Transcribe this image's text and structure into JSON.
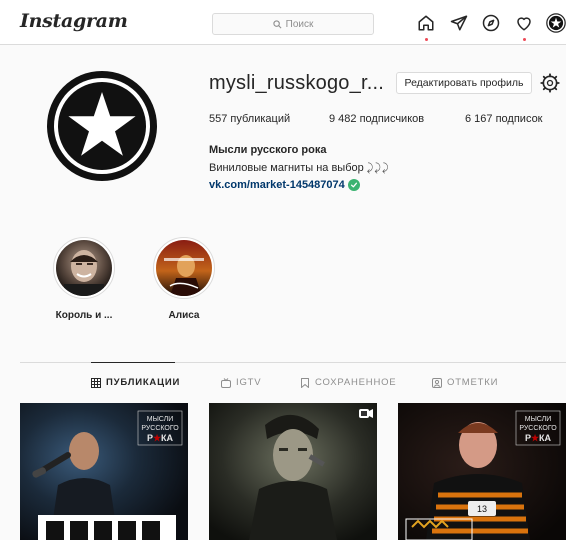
{
  "nav": {
    "logo": "Instagram",
    "search_placeholder": "Поиск",
    "icons": [
      "home-icon",
      "direct-icon",
      "explore-icon",
      "activity-icon",
      "profile-avatar-icon"
    ]
  },
  "profile": {
    "username": "mysli_russkogo_r...",
    "edit_button": "Редактировать профиль",
    "stats": {
      "posts_count": "557",
      "posts_label": "публикаций",
      "followers_count": "9 482",
      "followers_label": "подписчиков",
      "following_count": "6 167",
      "following_label": "подписок"
    },
    "full_name": "Мысли русского рока",
    "bio": "Виниловые магниты на выбор",
    "link": "vk.com/market-145487074"
  },
  "highlights": [
    {
      "label": "Король и ..."
    },
    {
      "label": "Алиса"
    }
  ],
  "tabs": [
    {
      "label": "ПУБЛИКАЦИИ",
      "active": true
    },
    {
      "label": "IGTV",
      "active": false
    },
    {
      "label": "СОХРАНЕННОЕ",
      "active": false
    },
    {
      "label": "ОТМЕТКИ",
      "active": false
    }
  ],
  "posts": [
    {
      "watermark": "МЫСЛИ РУССКОГО РОКА",
      "accent": "#c00000"
    },
    {
      "watermark": "",
      "accent": "#3a3a3a",
      "badge": "video-icon"
    },
    {
      "watermark": "МЫСЛИ РУССКОГО РОКА",
      "accent": "#d9730d",
      "tag_number": "13"
    }
  ],
  "colors": {
    "link": "#00376b",
    "notification_dot": "#ed4956",
    "verified": "#3cb371"
  }
}
